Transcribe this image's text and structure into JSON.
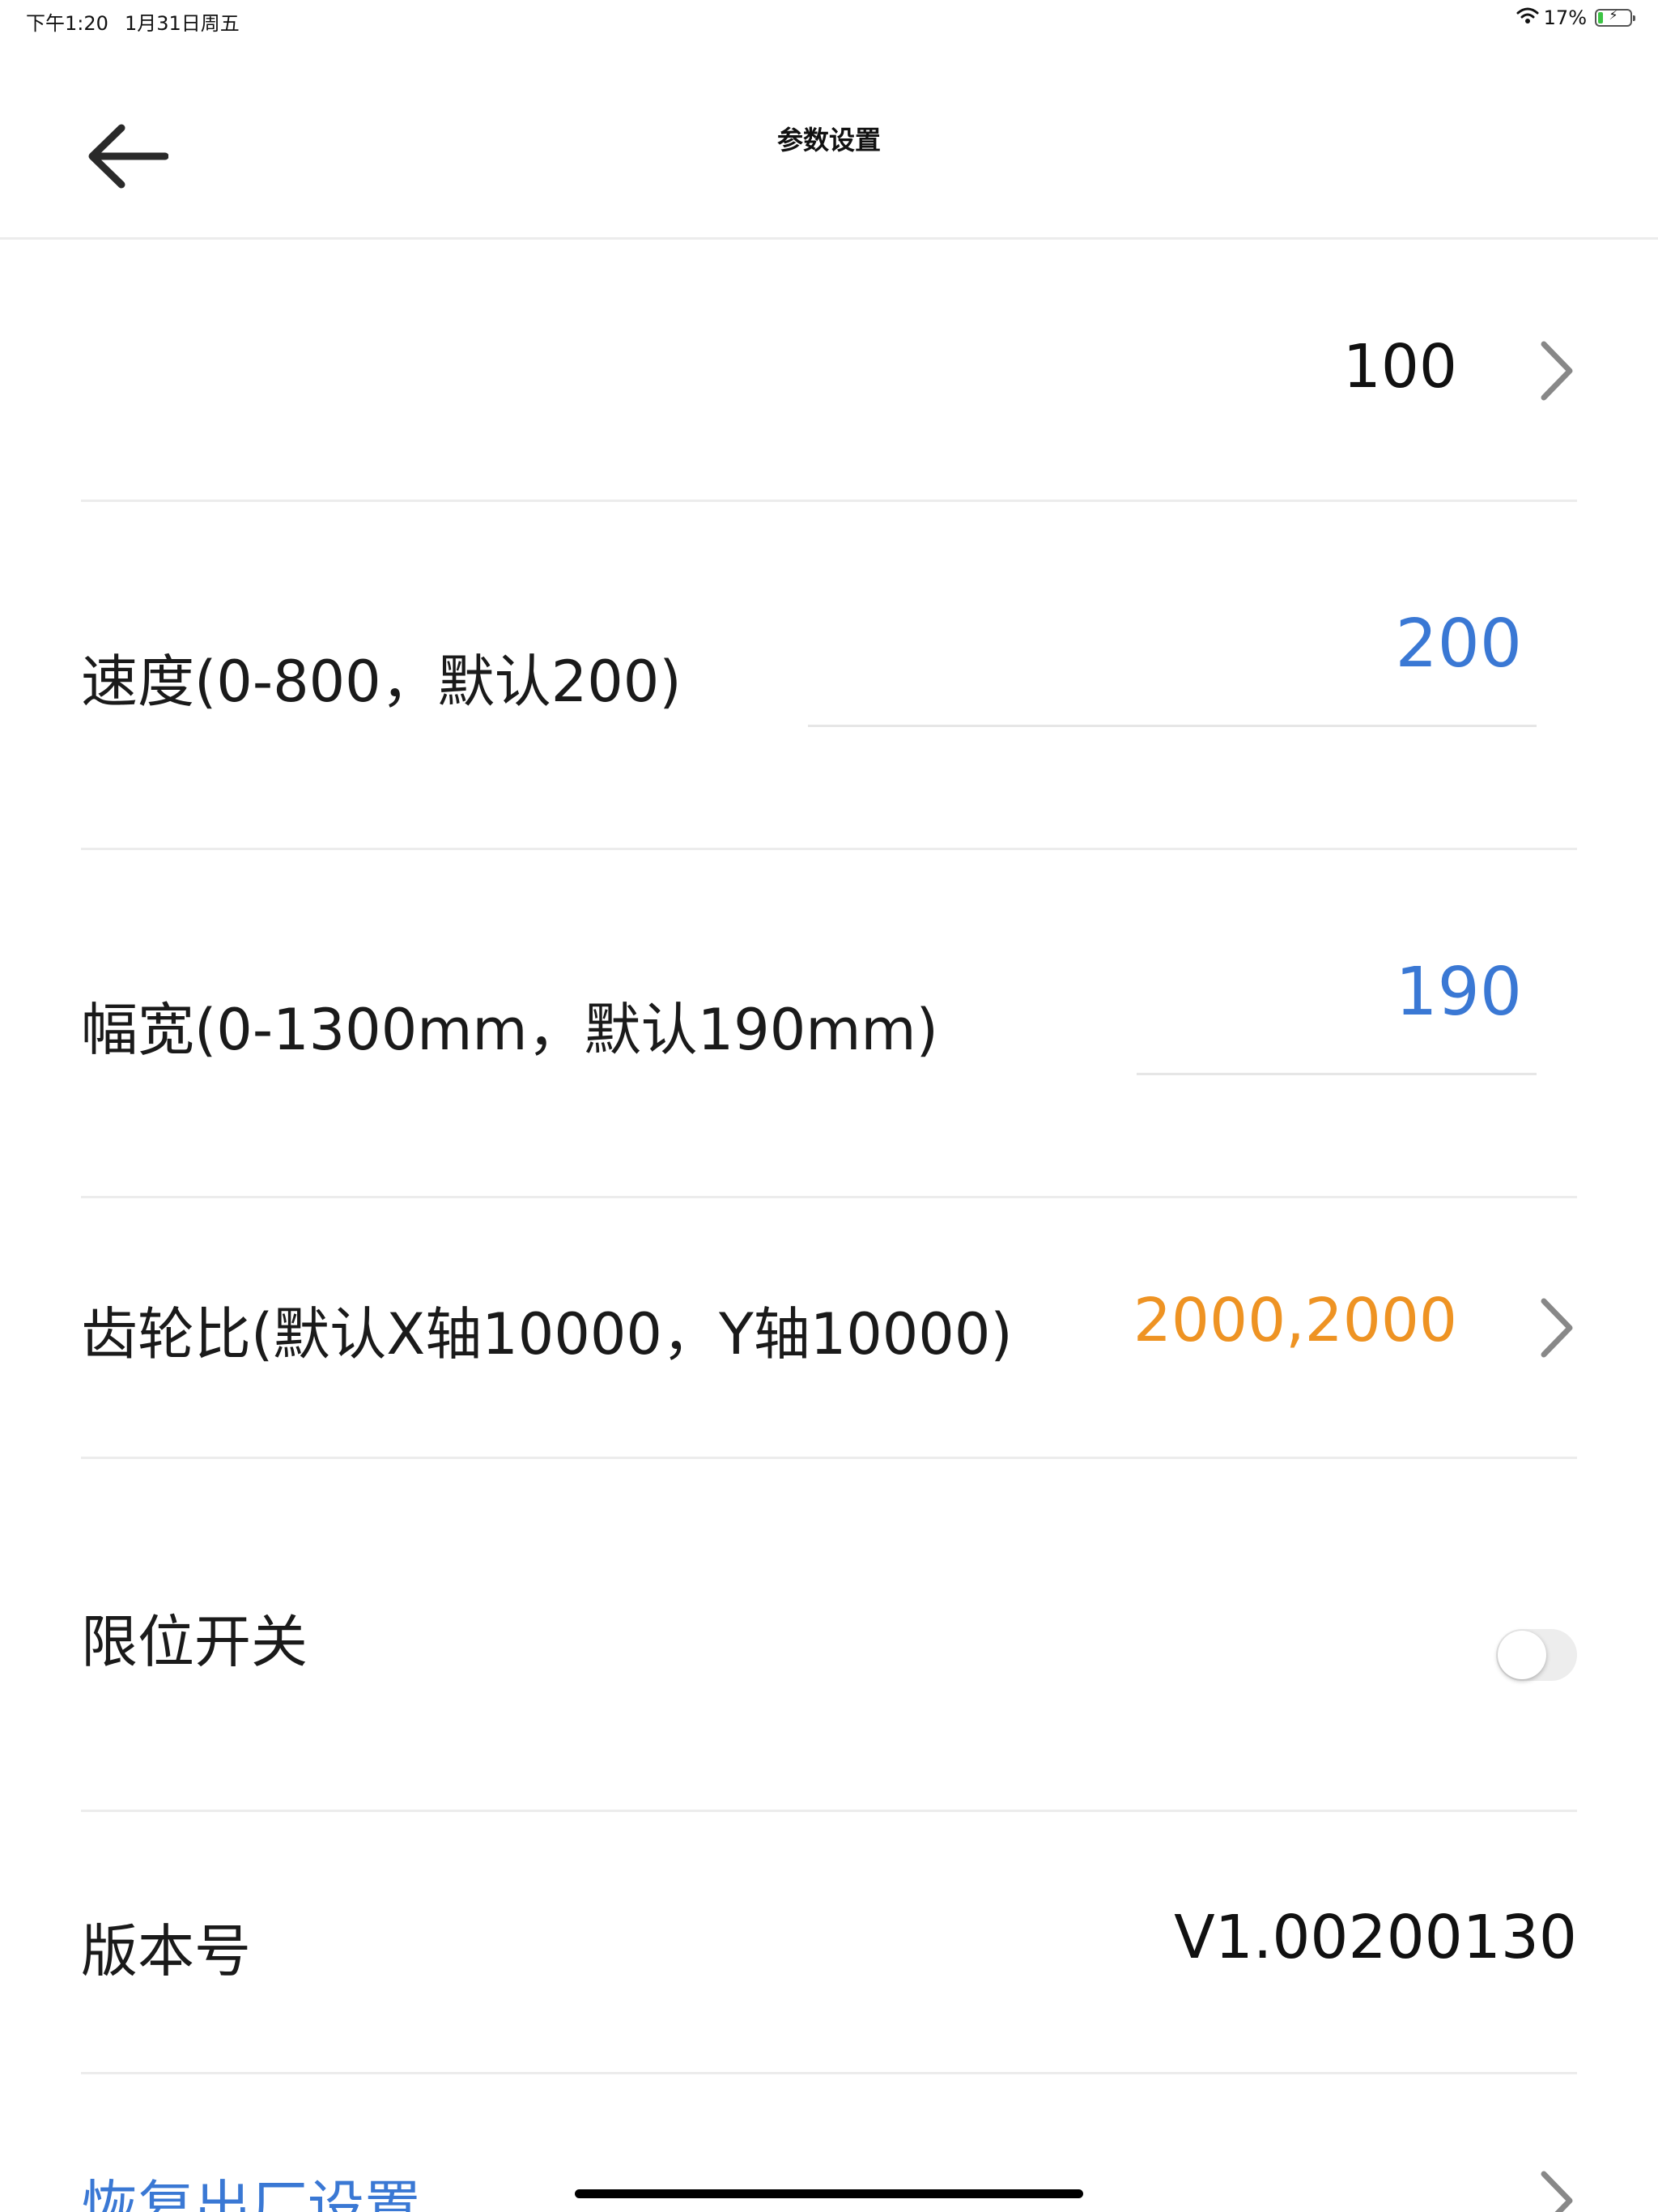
{
  "status_bar": {
    "time": "下午1:20",
    "date": "1月31日周五",
    "battery_percent": "17%",
    "battery_level": 0.17,
    "icons": [
      "wifi-icon",
      "battery-icon",
      "charging-bolt-icon"
    ]
  },
  "nav": {
    "title": "参数设置",
    "back_icon": "arrow-left-icon"
  },
  "rows": {
    "top_value": {
      "value": "100",
      "icon": "chevron-right-icon"
    },
    "speed": {
      "label": "速度(0-800，默认200)",
      "value": "200"
    },
    "width": {
      "label": "幅宽(0-1300mm，默认190mm)",
      "value": "190"
    },
    "gear_ratio": {
      "label": "齿轮比(默认X轴10000，Y轴10000)",
      "value": "2000,2000",
      "icon": "chevron-right-icon"
    },
    "limit_switch": {
      "label": "限位开关",
      "on": false
    },
    "version": {
      "label": "版本号",
      "value": "V1.00200130"
    },
    "factory_reset": {
      "label": "恢复出厂设置",
      "icon": "chevron-right-icon"
    }
  },
  "colors": {
    "input_value": "#3a78d4",
    "accent_orange": "#ee9323",
    "reset_link": "#3a78d4",
    "divider": "#ececec"
  }
}
